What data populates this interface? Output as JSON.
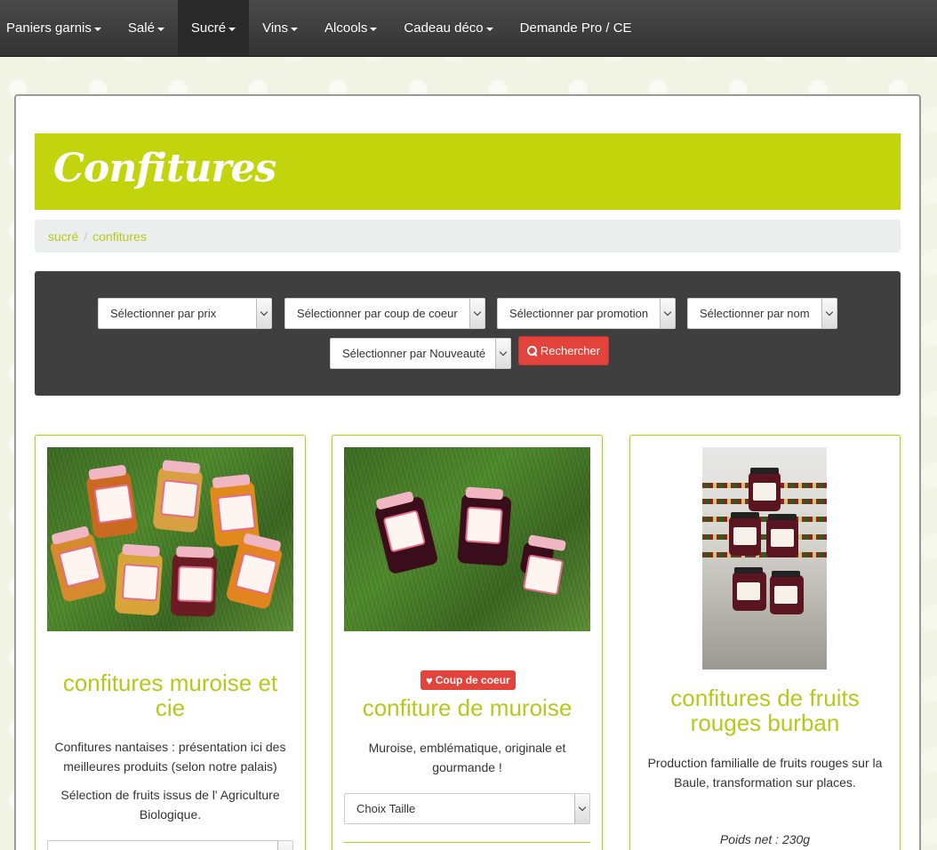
{
  "nav": {
    "items": [
      {
        "label": "Paniers garnis",
        "caret": true
      },
      {
        "label": "Salé",
        "caret": true
      },
      {
        "label": "Sucré",
        "caret": true,
        "active": true
      },
      {
        "label": "Vins",
        "caret": true
      },
      {
        "label": "Alcools",
        "caret": true
      },
      {
        "label": "Cadeau déco",
        "caret": true
      },
      {
        "label": "Demande Pro / CE",
        "caret": false
      }
    ]
  },
  "page": {
    "title": "Confitures"
  },
  "breadcrumb": {
    "items": [
      "sucré",
      "confitures"
    ],
    "separator": "/"
  },
  "filters": {
    "price": "Sélectionner par prix",
    "favorite": "Sélectionner par coup de coeur",
    "promotion": "Sélectionner par promotion",
    "name": "Sélectionner par nom",
    "new": "Sélectionner par Nouveauté",
    "search_label": "Rechercher"
  },
  "products": [
    {
      "title": "confitures muroise et cie",
      "text1": "Confitures nantaises : présentation ici des meilleures produits (selon notre palais)",
      "text2": "Sélection de fruits issus de l' Agriculture Biologique."
    },
    {
      "badge": "Coup de coeur",
      "title": "confiture de muroise",
      "text1": "Muroise, emblématique, originale et gourmande !",
      "select": "Choix Taille"
    },
    {
      "title": "confitures de fruits rouges burban",
      "text1": "Production familialle de fruits rouges sur la Baule, transformation sur places.",
      "weight": "Poids net : 230g"
    }
  ],
  "colors": {
    "accent": "#c2d40c",
    "link": "#b5c91c",
    "button": "#e2433a",
    "navbar": "#3c3c3c"
  }
}
